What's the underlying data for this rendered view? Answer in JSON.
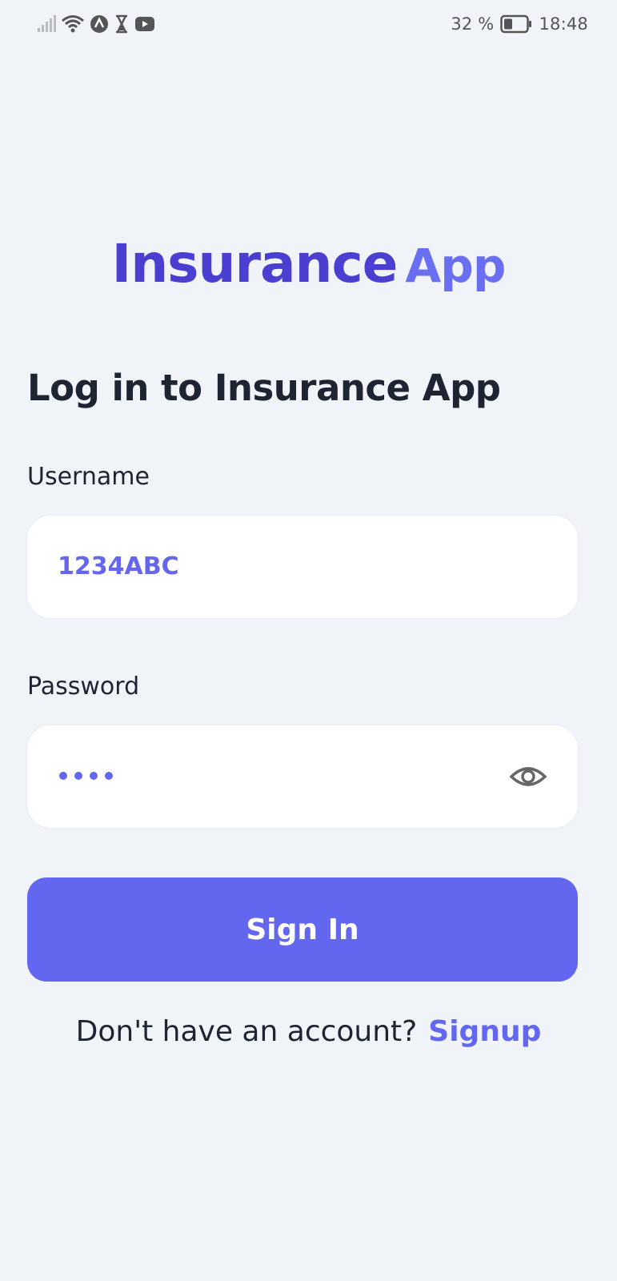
{
  "status_bar": {
    "battery_percent": "32 %",
    "battery_level": 0.32,
    "time": "18:48",
    "icons": [
      "signal-icon",
      "wifi-icon",
      "app-notification-icon",
      "hourglass-icon",
      "youtube-icon",
      "battery-icon"
    ]
  },
  "brand": {
    "name_part1": "Insurance",
    "name_part2": "App",
    "colors": {
      "primary_dark": "#4a3fd1",
      "primary": "#6366ef",
      "background": "#f0f4f9"
    }
  },
  "login": {
    "heading": "Log in to Insurance App",
    "username_label": "Username",
    "username_value": "1234ABC",
    "password_label": "Password",
    "password_masked": "••••",
    "sign_in_label": "Sign In",
    "no_account_text": "Don't have an account?",
    "signup_link": "Signup"
  }
}
